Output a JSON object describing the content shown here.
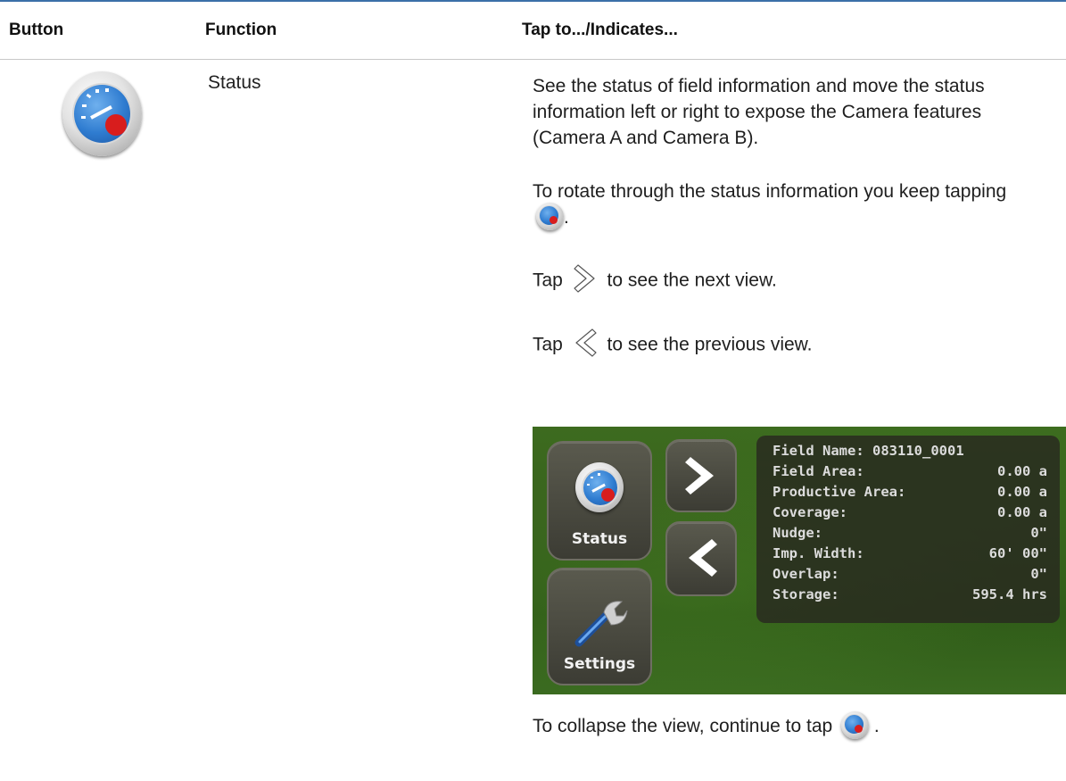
{
  "header": {
    "col_button": "Button",
    "col_function": "Function",
    "col_tap": "Tap to.../Indicates..."
  },
  "row": {
    "function": "Status",
    "button_icon": "status-gauge-icon",
    "p1": "See the status of field information and move the status information left or right to expose the Camera features (Camera A and Camera B).",
    "p2_text": "To rotate through the status information you keep tapping",
    "p2_end": ".",
    "p3_pre": "Tap",
    "p3_post": "to see the next view.",
    "p4_pre": "Tap",
    "p4_post": "to see the previous view.",
    "p5_text": "To collapse the view, continue to tap",
    "p5_end": "."
  },
  "screen": {
    "status_label": "Status",
    "settings_label": "Settings",
    "info": [
      {
        "label": "Field Name:",
        "value": "083110_0001"
      },
      {
        "label": "Field Area:",
        "value": "0.00 a"
      },
      {
        "label": "Productive Area:",
        "value": "0.00 a"
      },
      {
        "label": "Coverage:",
        "value": "0.00 a"
      },
      {
        "label": "Nudge:",
        "value": "0\""
      },
      {
        "label": "Imp. Width:",
        "value": "60' 00\""
      },
      {
        "label": "Overlap:",
        "value": "0\""
      },
      {
        "label": "Storage:",
        "value": "595.4 hrs"
      }
    ]
  },
  "colors": {
    "header_rule": "#3b6fa8",
    "gauge_face": "#2f7cd0",
    "gauge_red": "#d81d1d",
    "field_green": "#36601c"
  }
}
